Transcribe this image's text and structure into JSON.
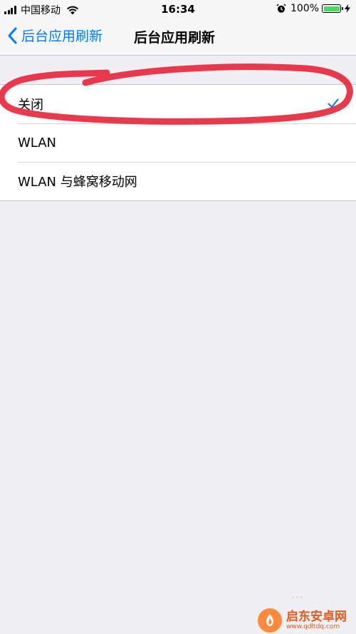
{
  "status_bar": {
    "carrier": "中国移动",
    "time": "16:34",
    "battery_percent": "100%",
    "battery_level": 1.0,
    "battery_color": "#4cd964"
  },
  "nav": {
    "back_label": "后台应用刷新",
    "title": "后台应用刷新",
    "accent_color": "#007aff"
  },
  "options": [
    {
      "label": "关闭",
      "selected": true
    },
    {
      "label": "WLAN",
      "selected": false
    },
    {
      "label": "WLAN 与蜂窝移动网",
      "selected": false
    }
  ],
  "annotation": {
    "color": "#e8283c",
    "shape": "hand-drawn-ellipse"
  },
  "watermark": {
    "title": "启东安卓网",
    "url": "www.qdltdq.com",
    "icon": "brand-logo-icon"
  },
  "icons": {
    "signal": "signal-bars-icon",
    "wifi": "wifi-icon",
    "alarm": "alarm-icon",
    "battery": "battery-icon",
    "charging": "charging-bolt-icon",
    "back": "chevron-left-icon",
    "check": "checkmark-icon"
  }
}
